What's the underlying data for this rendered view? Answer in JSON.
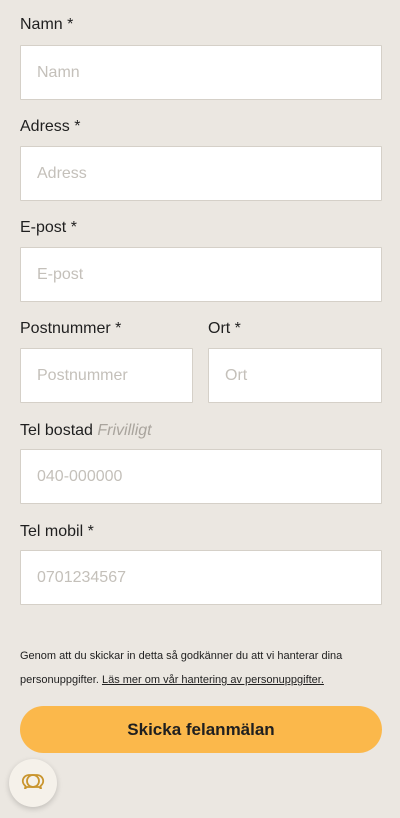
{
  "form": {
    "name": {
      "label": "Namn *",
      "placeholder": "Namn"
    },
    "address": {
      "label": "Adress *",
      "placeholder": "Adress"
    },
    "email": {
      "label": "E-post *",
      "placeholder": "E-post"
    },
    "postal_code": {
      "label": "Postnummer *",
      "placeholder": "Postnummer"
    },
    "city": {
      "label": "Ort *",
      "placeholder": "Ort"
    },
    "home_phone": {
      "label": "Tel bostad",
      "optional_hint": "Frivilligt",
      "placeholder": "040-000000"
    },
    "mobile_phone": {
      "label": "Tel mobil *",
      "placeholder": "0701234567"
    }
  },
  "consent": {
    "text": "Genom att du skickar in detta så godkänner du att vi hanterar dina personuppgifter.",
    "link_text": "Läs mer om vår hantering av personuppgifter."
  },
  "submit": {
    "label": "Skicka felanmälan"
  },
  "chat_button": {
    "icon": "chat-bubbles-icon"
  },
  "colors": {
    "background": "#ebe7e1",
    "accent": "#fbb84b",
    "input_background": "#ffffff",
    "placeholder_text": "#c4c0ba",
    "optional_hint_text": "#a9a49d",
    "chat_icon": "#c9952e"
  }
}
